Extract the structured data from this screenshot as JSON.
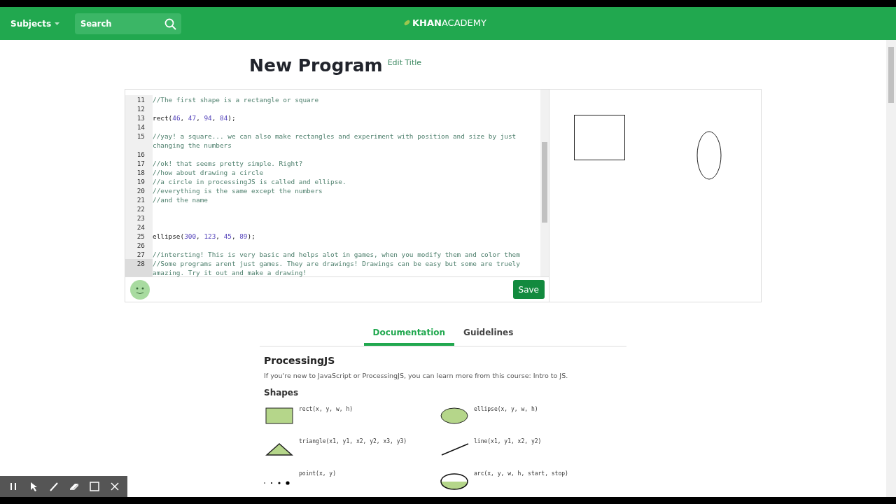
{
  "header": {
    "subjects": "Subjects",
    "search": {
      "placeholder": "Search"
    },
    "logo_bold": "KHAN",
    "logo_light": "ACADEMY"
  },
  "program": {
    "title": "New Program",
    "edit_link": "Edit Title"
  },
  "editor": {
    "lines": [
      {
        "number": "11",
        "kind": "comment",
        "text": "//The first shape is a rectangle or square",
        "selected": false
      },
      {
        "number": "12",
        "kind": "blank",
        "selected": false
      },
      {
        "number": "13",
        "kind": "code",
        "text": "rect(46, 47, 94, 84);",
        "selected": false
      },
      {
        "number": "14",
        "kind": "blank",
        "selected": false
      },
      {
        "number": "15",
        "kind": "comment",
        "text": "//yay! a square... we can also make rectangles and experiment with position and size by just changing the numbers",
        "selected": false
      },
      {
        "number": "16",
        "kind": "blank",
        "selected": false
      },
      {
        "number": "17",
        "kind": "comment",
        "text": "//ok! that seems pretty simple. Right?",
        "selected": false
      },
      {
        "number": "18",
        "kind": "comment",
        "text": "//how about drawing a circle",
        "selected": false
      },
      {
        "number": "19",
        "kind": "comment",
        "text": "//a circle in processingJS is called and ellipse.",
        "selected": false
      },
      {
        "number": "20",
        "kind": "comment",
        "text": "//everything is the same except the numbers",
        "selected": false
      },
      {
        "number": "21",
        "kind": "comment",
        "text": "//and the name",
        "selected": false
      },
      {
        "number": "22",
        "kind": "blank",
        "selected": false
      },
      {
        "number": "23",
        "kind": "blank",
        "selected": false
      },
      {
        "number": "24",
        "kind": "blank",
        "selected": false
      },
      {
        "number": "25",
        "kind": "code",
        "text": "ellipse(300, 123, 45, 89);",
        "selected": false
      },
      {
        "number": "26",
        "kind": "blank",
        "selected": false
      },
      {
        "number": "27",
        "kind": "comment",
        "text": "//intersting! This is very basic and helps alot in games, when you modify them and color them",
        "selected": false
      },
      {
        "number": "28",
        "kind": "comment",
        "text": "//Some programs arent just games. They are drawings! Drawings can be easy but some are truely amazing. Try it out and make a drawing!",
        "selected": true
      }
    ],
    "save": "Save"
  },
  "tabs": [
    {
      "label": "Documentation",
      "selected": true
    },
    {
      "label": "Guidelines",
      "selected": false
    }
  ],
  "docs": {
    "heading": "ProcessingJS",
    "intro": "If you're new to JavaScript or ProcessingJS, you can learn more from this course: Intro to JS.",
    "section": "Shapes",
    "shapes": [
      {
        "kind": "rect",
        "signature": "rect(x, y, w, h)"
      },
      {
        "kind": "ellipse",
        "signature": "ellipse(x, y, w, h)"
      },
      {
        "kind": "triangle",
        "signature": "triangle(x1, y1, x2, y2, x3, y3)"
      },
      {
        "kind": "line",
        "signature": "line(x1, y1, x2, y2)"
      },
      {
        "kind": "point",
        "signature": "point(x, y)"
      },
      {
        "kind": "arc",
        "signature": "arc(x, y, w, h, start, stop)"
      }
    ]
  },
  "recorder_toolbar": {
    "tools": [
      {
        "kind": "pause"
      },
      {
        "kind": "pointer"
      },
      {
        "kind": "pen"
      },
      {
        "kind": "eraser"
      },
      {
        "kind": "rectangle"
      },
      {
        "kind": "close"
      }
    ]
  }
}
